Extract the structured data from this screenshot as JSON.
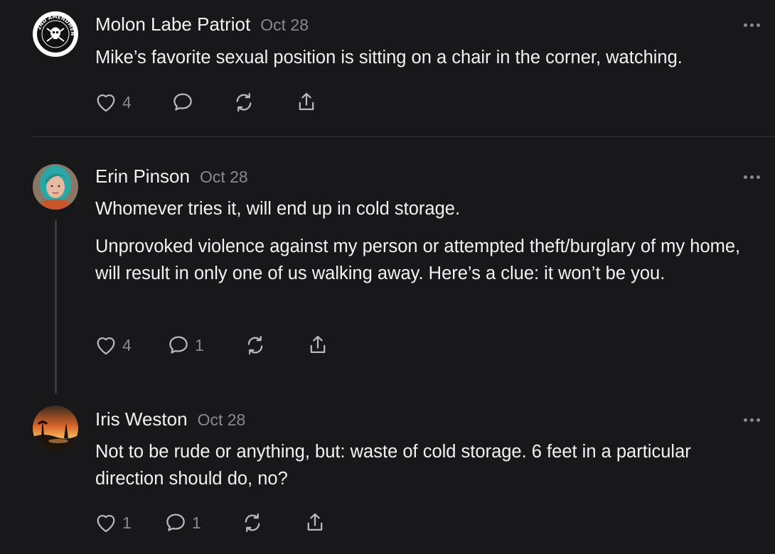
{
  "posts": [
    {
      "author": "Molon Labe Patriot",
      "date": "Oct 28",
      "avatar": "2nd-amendment-skull-logo",
      "paragraphs": [
        "Mike’s favorite sexual position is sitting on a chair in the corner, watching."
      ],
      "likes": "4",
      "replies": "",
      "avatar_text": "2ND AMENDMENT"
    },
    {
      "author": "Erin Pinson",
      "date": "Oct 28",
      "avatar": "profile-photo-teal-hair-woman",
      "paragraphs": [
        "Whomever tries it, will end up in cold storage.",
        "Unprovoked violence against my person or attempted theft/burglary of my home, will result in only one of us walking away. Here’s a clue: it won’t be you."
      ],
      "likes": "4",
      "replies": "1"
    },
    {
      "author": "Iris Weston",
      "date": "Oct 28",
      "avatar": "sunset-landscape-painting",
      "paragraphs": [
        "Not to be rude or anything, but: waste of cold storage. 6 feet in a particular direction should do, no?"
      ],
      "likes": "1",
      "replies": "1"
    }
  ],
  "icons": {
    "like": "heart-icon",
    "reply": "comment-bubble-icon",
    "repost": "repost-icon",
    "share": "share-upload-icon",
    "more": "more-dots-icon"
  },
  "colors": {
    "background": "#18181a",
    "text": "#f2f2f2",
    "muted": "#8a8a8e",
    "divider": "#333336"
  }
}
